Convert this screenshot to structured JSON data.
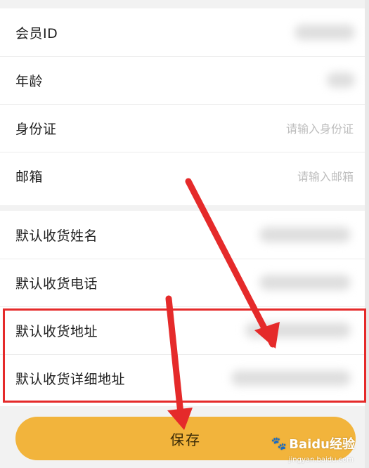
{
  "profile": {
    "member_id_label": "会员ID",
    "age_label": "年龄",
    "id_card_label": "身份证",
    "id_card_placeholder": "请输入身份证",
    "email_label": "邮箱",
    "email_placeholder": "请输入邮箱"
  },
  "shipping": {
    "name_label": "默认收货姓名",
    "phone_label": "默认收货电话",
    "address_label": "默认收货地址",
    "detail_address_label": "默认收货详细地址"
  },
  "actions": {
    "save_label": "保存"
  },
  "watermark": {
    "brand": "Baidu经验",
    "url": "jingyan.baidu.com"
  },
  "colors": {
    "accent": "#f2b43c",
    "annotation": "#e52a2a"
  }
}
